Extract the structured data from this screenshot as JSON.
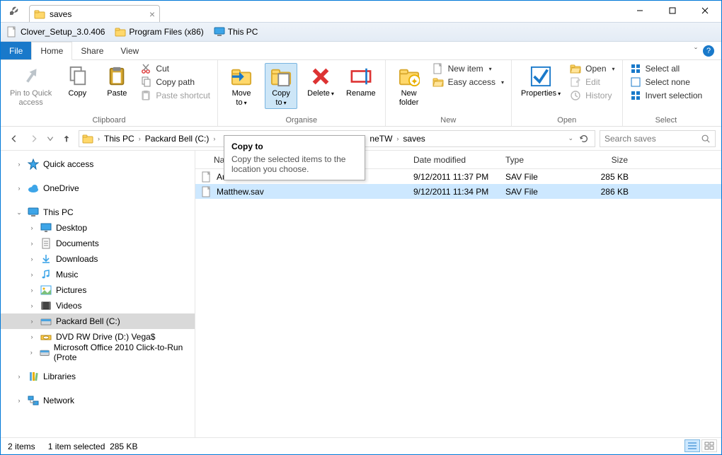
{
  "window": {
    "tab_title": "saves"
  },
  "bookmarks": [
    {
      "label": "Clover_Setup_3.0.406",
      "icon": "file"
    },
    {
      "label": "Program Files (x86)",
      "icon": "folder"
    },
    {
      "label": "This PC",
      "icon": "monitor"
    }
  ],
  "ribbon_tabs": {
    "file": "File",
    "home": "Home",
    "share": "Share",
    "view": "View"
  },
  "ribbon": {
    "clipboard": {
      "label": "Clipboard",
      "pin": "Pin to Quick\naccess",
      "copy": "Copy",
      "paste": "Paste",
      "cut": "Cut",
      "copy_path": "Copy path",
      "paste_shortcut": "Paste shortcut"
    },
    "organise": {
      "label": "Organise",
      "move_to": "Move\nto",
      "copy_to": "Copy\nto",
      "delete": "Delete",
      "rename": "Rename"
    },
    "new": {
      "label": "New",
      "new_folder": "New\nfolder",
      "new_item": "New item",
      "easy_access": "Easy access"
    },
    "open": {
      "label": "Open",
      "properties": "Properties",
      "open": "Open",
      "edit": "Edit",
      "history": "History"
    },
    "select": {
      "label": "Select",
      "select_all": "Select all",
      "select_none": "Select none",
      "invert": "Invert selection"
    }
  },
  "tooltip": {
    "title": "Copy to",
    "body": "Copy the selected items to the location you choose."
  },
  "breadcrumb": [
    "This PC",
    "Packard Bell (C:)",
    "neTW",
    "saves"
  ],
  "breadcrumb_hidden_segment": "neTW",
  "search": {
    "placeholder": "Search saves"
  },
  "tree": {
    "quick_access": "Quick access",
    "onedrive": "OneDrive",
    "this_pc": "This PC",
    "desktop": "Desktop",
    "documents": "Documents",
    "downloads": "Downloads",
    "music": "Music",
    "pictures": "Pictures",
    "videos": "Videos",
    "c_drive": "Packard Bell (C:)",
    "dvd": "DVD RW Drive (D:) Vega$",
    "office": "Microsoft Office 2010 Click-to-Run (Prote",
    "libraries": "Libraries",
    "network": "Network"
  },
  "columns": {
    "name": "Name",
    "date": "Date modified",
    "type": "Type",
    "size": "Size"
  },
  "files": [
    {
      "name": "Autosave.sav",
      "date": "9/12/2011 11:37 PM",
      "type": "SAV File",
      "size": "285 KB",
      "selected": false
    },
    {
      "name": "Matthew.sav",
      "date": "9/12/2011 11:34 PM",
      "type": "SAV File",
      "size": "286 KB",
      "selected": true
    }
  ],
  "status": {
    "count": "2 items",
    "selection": "1 item selected",
    "selsize": "285 KB"
  }
}
